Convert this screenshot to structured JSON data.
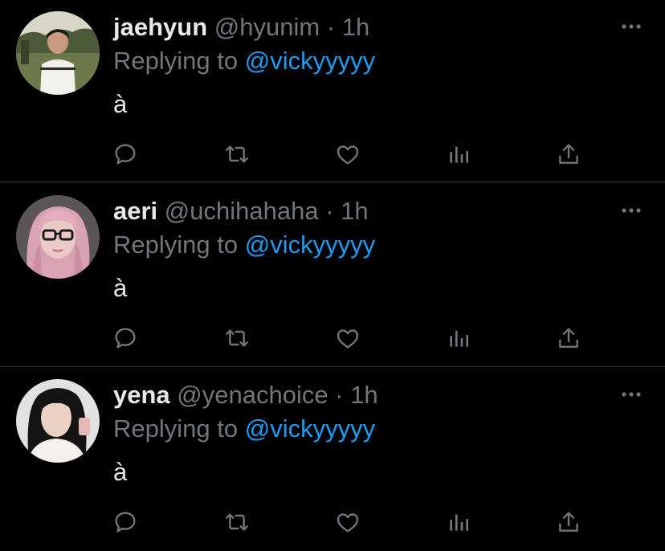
{
  "colors": {
    "background": "#000000",
    "primary_text": "#e7e9ea",
    "secondary_text": "#71767b",
    "accent": "#1d9bf0",
    "divider": "#2f3336",
    "icon": "#71767b"
  },
  "tweets": [
    {
      "name": "jaehyun",
      "handle": "@hyunim",
      "separator": "·",
      "time": "1h",
      "reply_prefix": "Replying to",
      "reply_to": "@vickyyyyy",
      "text": "à",
      "avatar_desc": "boy-in-park-avatar"
    },
    {
      "name": "aeri",
      "handle": "@uchihahaha",
      "separator": "·",
      "time": "1h",
      "reply_prefix": "Replying to",
      "reply_to": "@vickyyyyy",
      "text": "à",
      "avatar_desc": "pink-hair-girl-avatar"
    },
    {
      "name": "yena",
      "handle": "@yenachoice",
      "separator": "·",
      "time": "1h",
      "reply_prefix": "Replying to",
      "reply_to": "@vickyyyyy",
      "text": "à",
      "avatar_desc": "black-hair-girl-avatar"
    }
  ],
  "icons": {
    "more": "more-horizontal-icon",
    "reply": "reply-icon",
    "retweet": "retweet-icon",
    "like": "heart-icon",
    "stats": "analytics-icon",
    "share": "share-icon"
  }
}
